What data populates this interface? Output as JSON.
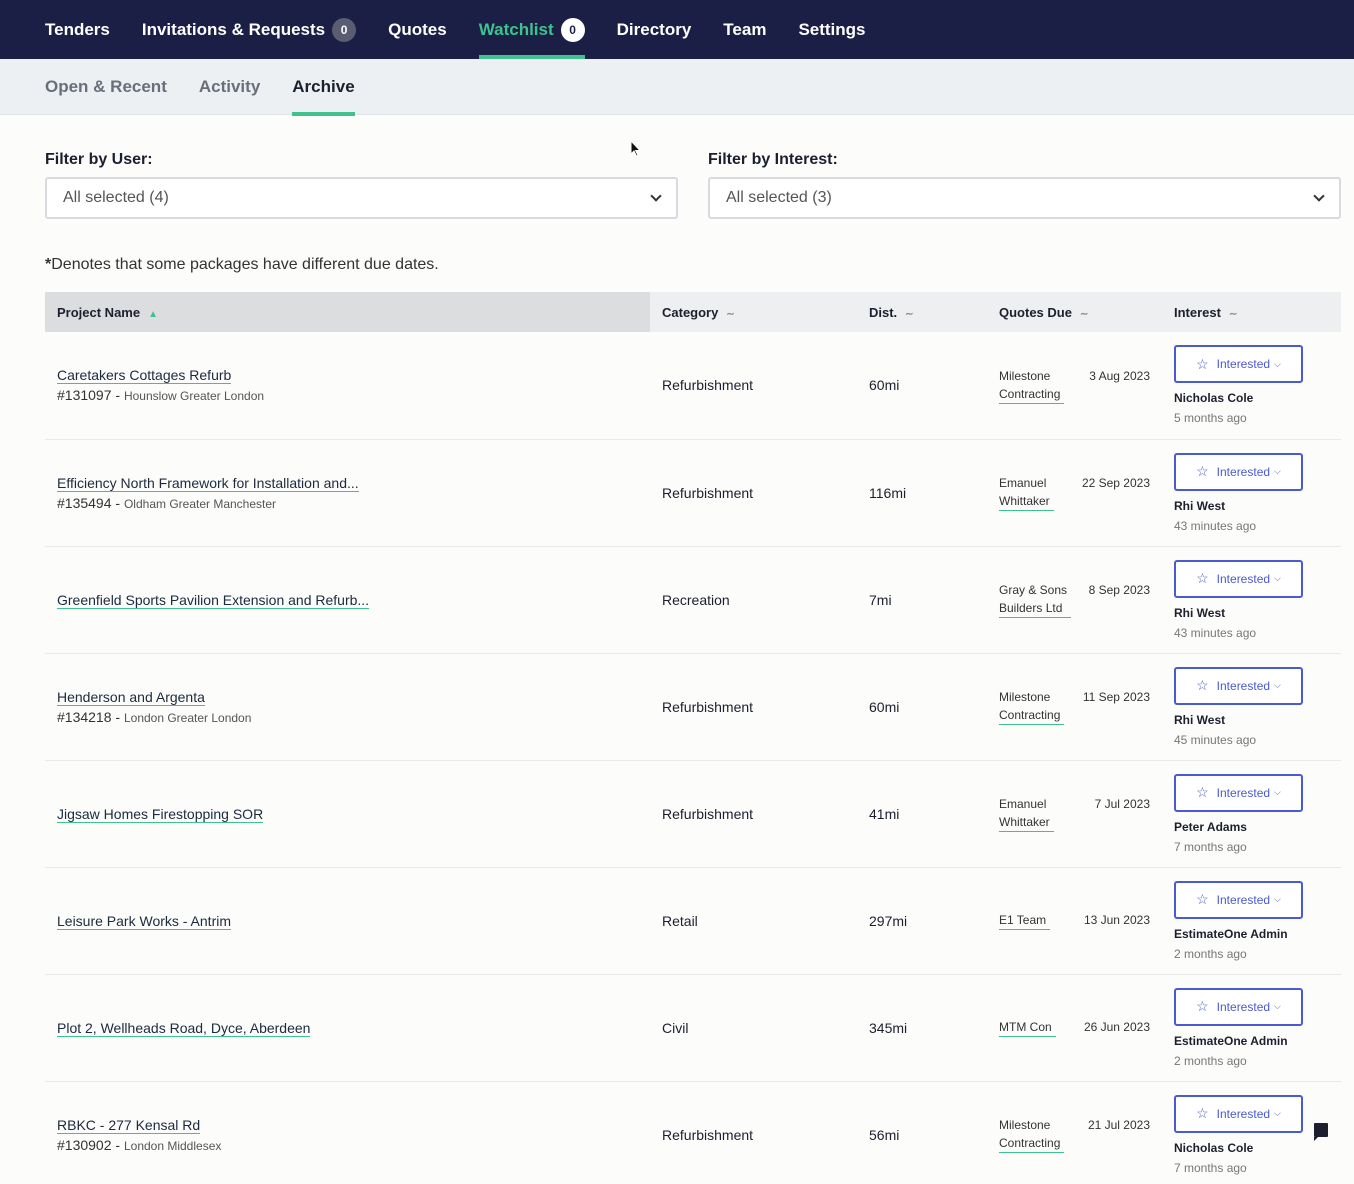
{
  "topnav": {
    "items": [
      {
        "label": "Tenders"
      },
      {
        "label": "Invitations & Requests",
        "badge": "0"
      },
      {
        "label": "Quotes"
      },
      {
        "label": "Watchlist",
        "badge": "0",
        "active": true
      },
      {
        "label": "Directory"
      },
      {
        "label": "Team"
      },
      {
        "label": "Settings"
      }
    ]
  },
  "subnav": {
    "items": [
      {
        "label": "Open & Recent"
      },
      {
        "label": "Activity"
      },
      {
        "label": "Archive",
        "active": true
      }
    ]
  },
  "filters": {
    "user_label": "Filter by User:",
    "user_value": "All selected (4)",
    "interest_label": "Filter by Interest:",
    "interest_value": "All selected (3)"
  },
  "note": {
    "asterisk": "*",
    "text": "Denotes that some packages have different due dates."
  },
  "table": {
    "headers": {
      "project": "Project Name",
      "category": "Category",
      "dist": "Dist.",
      "quotes_due": "Quotes Due",
      "interest": "Interest"
    },
    "interest_label": "Interested",
    "rows": [
      {
        "name": "Caretakers Cottages Refurb",
        "id": "#131097",
        "sep": " - ",
        "location": "Hounslow Greater London",
        "category": "Refurbishment",
        "dist": "60mi",
        "builder": [
          "Milestone",
          "Contracting"
        ],
        "due": "3 Aug 2023",
        "user": "Nicholas Cole",
        "ago": "5 months ago"
      },
      {
        "name": "Efficiency North Framework for Installation and...",
        "id": "#135494",
        "sep": " - ",
        "location": "Oldham Greater Manchester",
        "category": "Refurbishment",
        "dist": "116mi",
        "builder": [
          "Emanuel",
          "Whittaker"
        ],
        "due": "22 Sep 2023",
        "user": "Rhi West",
        "ago": "43 minutes ago"
      },
      {
        "name": "Greenfield Sports Pavilion Extension and Refurb...",
        "id": "",
        "sep": "",
        "location": "",
        "category": "Recreation",
        "dist": "7mi",
        "builder": [
          "Gray & Sons",
          "Builders Ltd"
        ],
        "due": "8 Sep 2023",
        "user": "Rhi West",
        "ago": "43 minutes ago"
      },
      {
        "name": "Henderson and Argenta",
        "id": "#134218",
        "sep": " - ",
        "location": "London Greater London",
        "category": "Refurbishment",
        "dist": "60mi",
        "builder": [
          "Milestone",
          "Contracting"
        ],
        "due": "11 Sep 2023",
        "user": "Rhi West",
        "ago": "45 minutes ago"
      },
      {
        "name": "Jigsaw Homes Firestopping SOR",
        "id": "",
        "sep": "",
        "location": "",
        "category": "Refurbishment",
        "dist": "41mi",
        "builder": [
          "Emanuel",
          "Whittaker"
        ],
        "due": "7 Jul 2023",
        "user": "Peter Adams",
        "ago": "7 months ago"
      },
      {
        "name": "Leisure Park Works - Antrim",
        "id": "",
        "sep": "",
        "location": "",
        "category": "Retail",
        "dist": "297mi",
        "builder": [
          "E1 Team"
        ],
        "due": "13 Jun 2023",
        "user": "EstimateOne Admin",
        "ago": "2 months ago"
      },
      {
        "name": "Plot 2, Wellheads Road, Dyce, Aberdeen",
        "id": "",
        "sep": "",
        "location": "",
        "category": "Civil",
        "dist": "345mi",
        "builder": [
          "MTM Con"
        ],
        "due": "26 Jun 2023",
        "user": "EstimateOne Admin",
        "ago": "2 months ago"
      },
      {
        "name": "RBKC - 277 Kensal Rd",
        "id": "#130902",
        "sep": " - ",
        "location": "London Middlesex",
        "category": "Refurbishment",
        "dist": "56mi",
        "builder": [
          "Milestone",
          "Contracting"
        ],
        "due": "21 Jul 2023",
        "user": "Nicholas Cole",
        "ago": "7 months ago"
      }
    ]
  },
  "colors": {
    "nav_bg": "#1b1f45",
    "accent": "#3fc28d",
    "interest": "#4a5ad1"
  }
}
